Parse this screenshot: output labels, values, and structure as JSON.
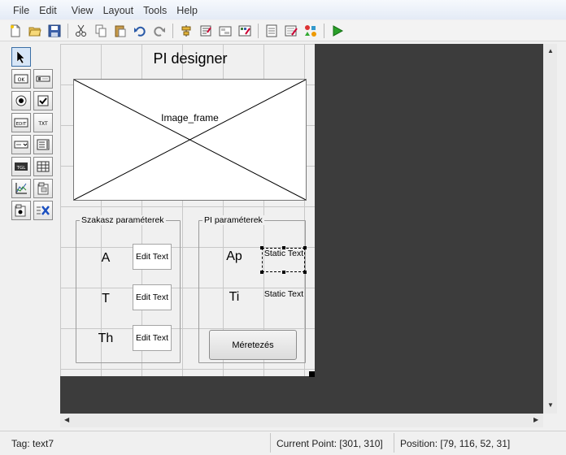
{
  "menu": [
    "File",
    "Edit",
    "View",
    "Layout",
    "Tools",
    "Help"
  ],
  "toolbar": {
    "icons": [
      "new-file-icon",
      "open-folder-icon",
      "save-icon",
      "cut-icon",
      "copy-icon",
      "paste-icon",
      "undo-icon",
      "redo-icon",
      "align-icon",
      "menu-editor-icon",
      "tab-order-icon",
      "toolbar-editor-icon",
      "mfile-editor-icon",
      "property-inspector-icon",
      "object-browser-icon",
      "run-icon"
    ]
  },
  "palette": [
    "select-tool",
    "push-button",
    "slider",
    "radio-button",
    "checkbox",
    "edit-text",
    "static-text",
    "popup-menu",
    "listbox",
    "toggle-button",
    "table",
    "axes",
    "panel",
    "button-group",
    "activex-control"
  ],
  "canvas": {
    "title": "PI designer",
    "image_frame_label": "Image_frame",
    "panel_left": {
      "title": "Szakasz paraméterek",
      "labels": [
        "A",
        "T",
        "Th"
      ],
      "edit_texts": [
        "Edit Text",
        "Edit Text",
        "Edit Text"
      ]
    },
    "panel_right": {
      "title": "PI paraméterek",
      "labels": [
        "Ap",
        "Ti"
      ],
      "static_texts": [
        "Static Text",
        "Static Text"
      ],
      "button_label": "Méretezés"
    }
  },
  "status": {
    "tag": "Tag: text7",
    "current_point": "Current Point:  [301, 310]",
    "position": "Position: [79, 116, 52, 31]"
  }
}
